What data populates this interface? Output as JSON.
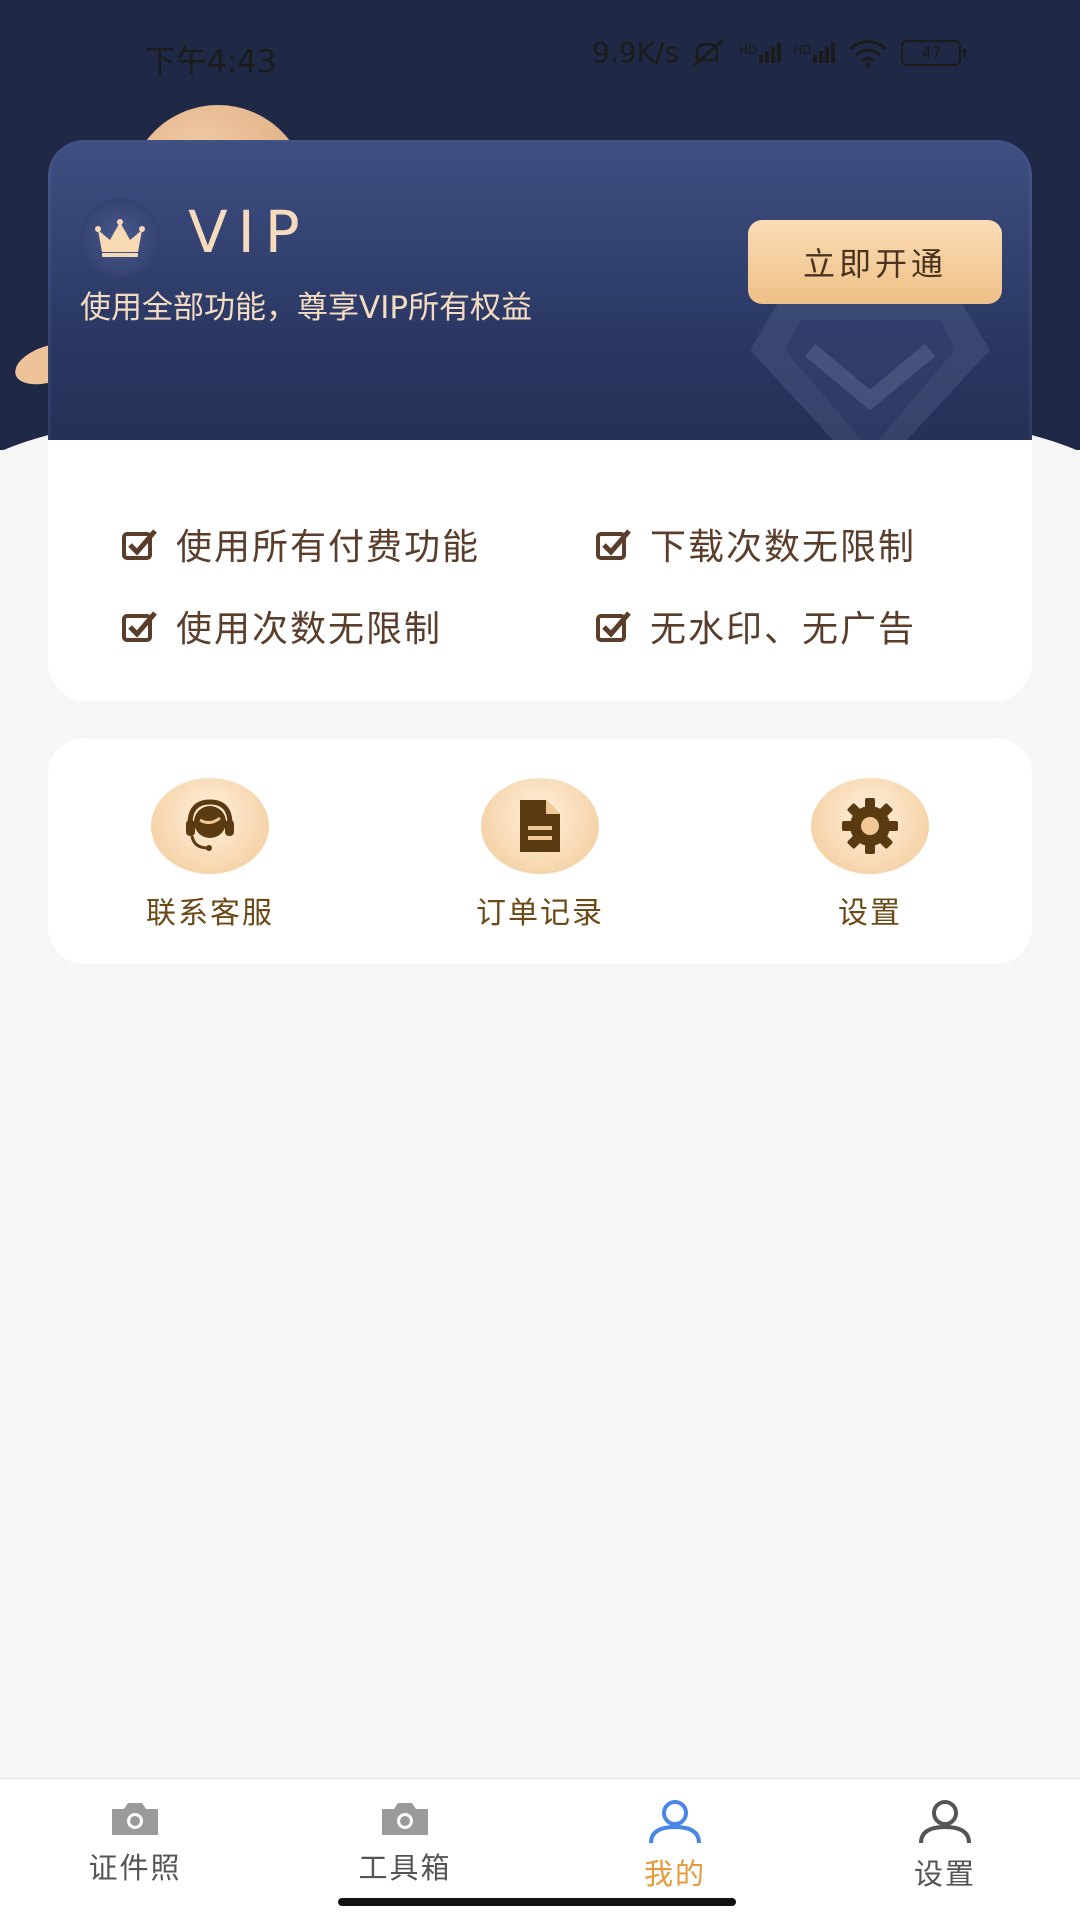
{
  "status_bar": {
    "time": "下午4:43",
    "network_speed": "9.9K/s",
    "signal1": "HD",
    "signal2": "HD",
    "battery": "47"
  },
  "vip_card": {
    "title": "VIP",
    "subtitle": "使用全部功能，尊享VIP所有权益",
    "cta_label": "立即开通"
  },
  "benefits": [
    {
      "label": "使用所有付费功能"
    },
    {
      "label": "下载次数无限制"
    },
    {
      "label": "使用次数无限制"
    },
    {
      "label": "无水印、无广告"
    }
  ],
  "tools": [
    {
      "label": "联系客服",
      "icon": "headset-icon"
    },
    {
      "label": "订单记录",
      "icon": "document-icon"
    },
    {
      "label": "设置",
      "icon": "gear-icon"
    }
  ],
  "tabbar": {
    "items": [
      {
        "label": "证件照",
        "icon": "camera-icon",
        "active": false
      },
      {
        "label": "工具箱",
        "icon": "camera-icon",
        "active": false
      },
      {
        "label": "我的",
        "icon": "person-icon",
        "active": true
      },
      {
        "label": "设置",
        "icon": "person-icon",
        "active": false
      }
    ]
  },
  "colors": {
    "header_bg": "#1f2845",
    "accent_gold": "#efc087",
    "benefit_text": "#5a3d2b",
    "tab_active": "#e69a3a"
  }
}
